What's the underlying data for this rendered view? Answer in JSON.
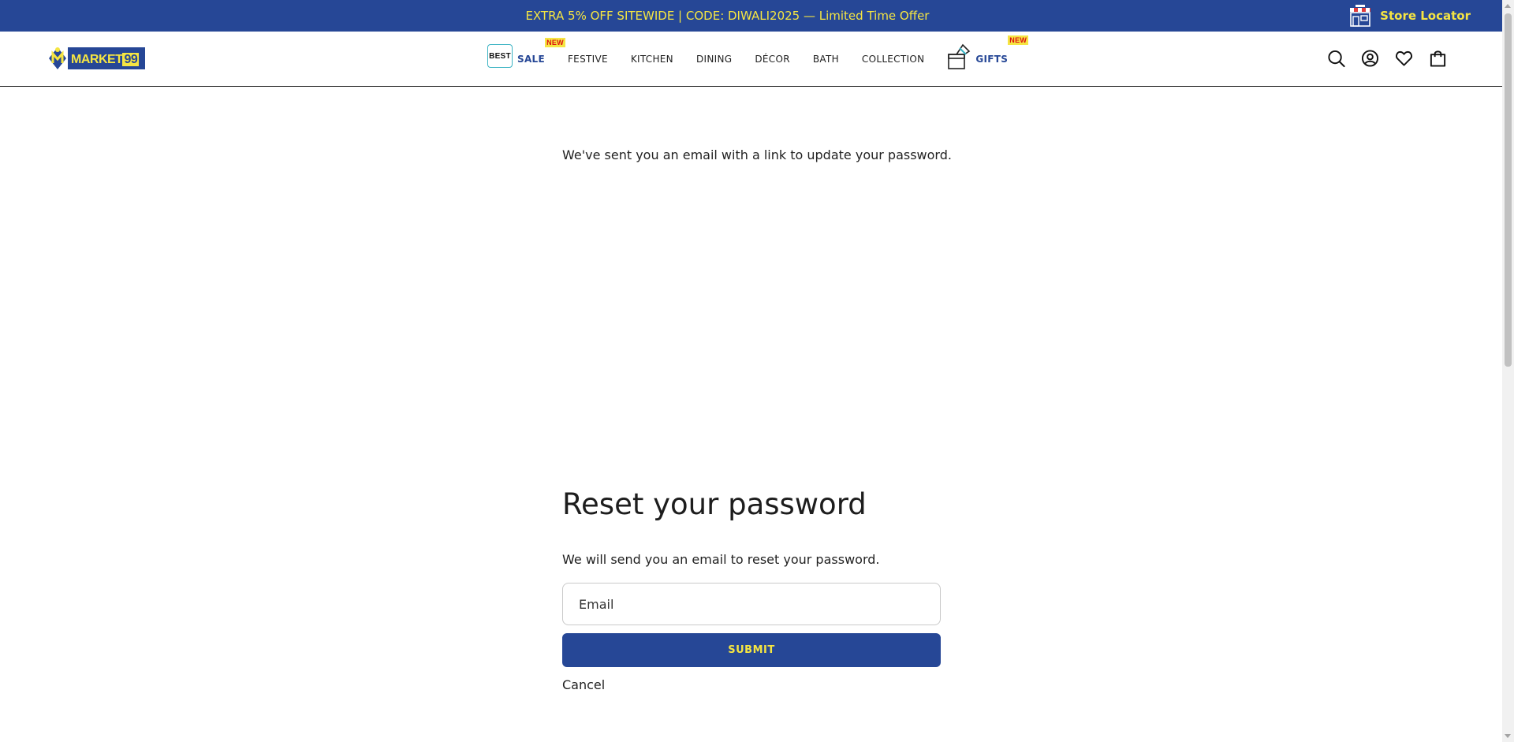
{
  "announcement": {
    "promo_text": "EXTRA 5% OFF SITEWIDE | CODE: DIWALI2025 — Limited Time Offer",
    "store_locator_label": "Store Locator"
  },
  "header": {
    "logo_text_main": "MARKET",
    "logo_text_num": "99",
    "nav": {
      "best_badge": "BEST",
      "sale": "SALE",
      "sale_new": "NEW",
      "festive": "FESTIVE",
      "kitchen": "KITCHEN",
      "dining": "DINING",
      "decor": "DÉCOR",
      "bath": "BATH",
      "collection": "COLLECTION",
      "gifts": "GIFTS",
      "gifts_new": "NEW"
    },
    "icons": [
      "search-icon",
      "account-icon",
      "wishlist-icon",
      "cart-icon"
    ]
  },
  "main": {
    "success_message": "We've sent you an email with a link to update your password.",
    "reset": {
      "title": "Reset your password",
      "subtitle": "We will send you an email to reset your password.",
      "email_placeholder": "Email",
      "email_value": "",
      "submit_label": "SUBMIT",
      "cancel_label": "Cancel"
    }
  },
  "colors": {
    "brand_blue": "#264796",
    "brand_yellow": "#f5e542"
  }
}
